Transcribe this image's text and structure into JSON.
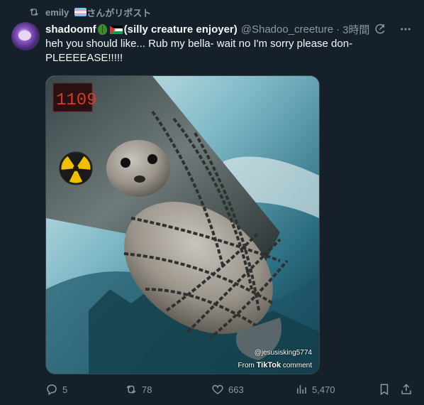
{
  "repost": {
    "name": "emily",
    "suffix": "さんがリポスト"
  },
  "author": {
    "display_name": "shadoomf",
    "display_suffix": "(silly creature enjoyer)",
    "handle": "@Shadoo_creeture",
    "separator": "·",
    "time": "3時間"
  },
  "tweet": {
    "text": "heh you should like... Rub my bella- wait no I'm sorry please don-PLEEEEASE!!!!!"
  },
  "media": {
    "watermark_handle": "@jesusisking5774",
    "watermark_from": "From",
    "watermark_brand": "TikTok",
    "watermark_suffix": "comment"
  },
  "actions": {
    "replies": "5",
    "reposts": "78",
    "likes": "663",
    "views": "5,470"
  },
  "colors": {
    "background": "#15202b",
    "text": "#f7f9f9",
    "muted": "#8b98a5",
    "border": "#38444d"
  },
  "icons": {
    "repost": "repost-icon",
    "grok": "grok-icon",
    "more": "more-icon",
    "reply": "reply-icon",
    "like": "heart-icon",
    "views": "views-icon",
    "bookmark": "bookmark-icon",
    "share": "share-icon"
  }
}
